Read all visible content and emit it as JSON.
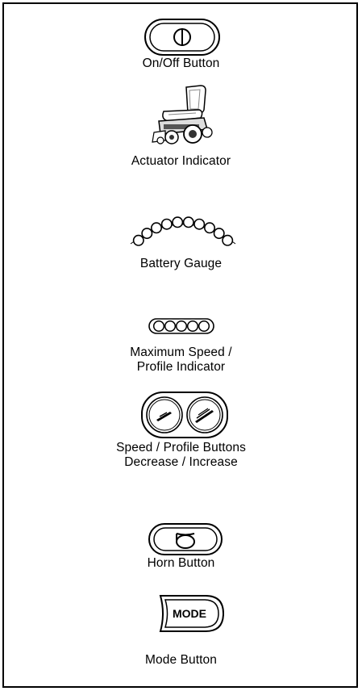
{
  "labels": {
    "on_off": "On/Off Button",
    "actuator": "Actuator Indicator",
    "battery": "Battery Gauge",
    "max_speed_line1": "Maximum Speed /",
    "max_speed_line2": "Profile Indicator",
    "speed_buttons_line1": "Speed / Profile Buttons",
    "speed_buttons_line2": "Decrease / Increase",
    "horn": "Horn Button",
    "mode": "Mode Button"
  },
  "mode_button_text": "MODE",
  "battery_gauge_segments": 10,
  "max_speed_indicator_segments": 5,
  "icons": [
    "power-icon",
    "wheelchair-icon",
    "battery-gauge-icon",
    "speed-indicator-icon",
    "speed-decrease-icon",
    "speed-increase-icon",
    "horn-icon",
    "mode-button"
  ]
}
